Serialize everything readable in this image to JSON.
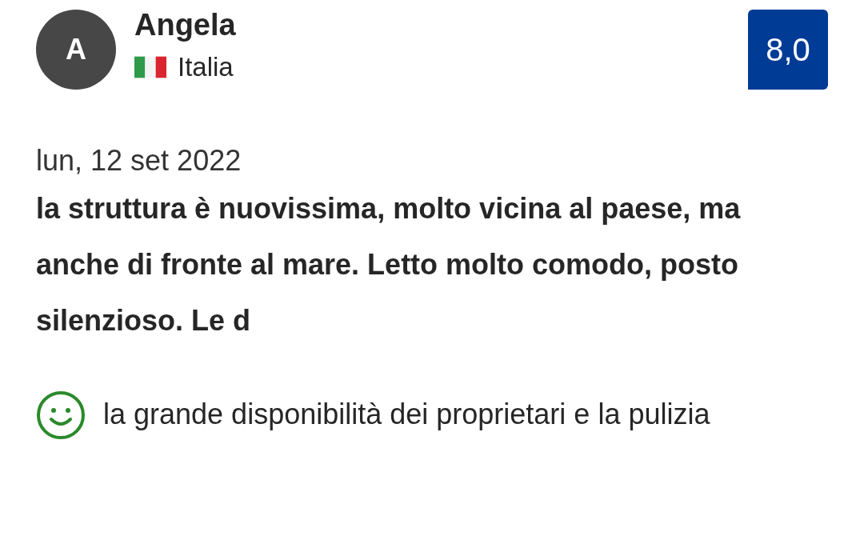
{
  "review": {
    "avatar_initial": "A",
    "name": "Angela",
    "country": "Italia",
    "score": "8,0",
    "date": "lun, 12 set 2022",
    "title": "la struttura è nuovissima, molto vicina al paese, ma anche di fronte al mare. Letto molto comodo, posto silenzioso. Le d",
    "points": [
      {
        "kind": "positive",
        "text": "la grande disponibilità dei proprietari e la pulizia"
      }
    ]
  }
}
